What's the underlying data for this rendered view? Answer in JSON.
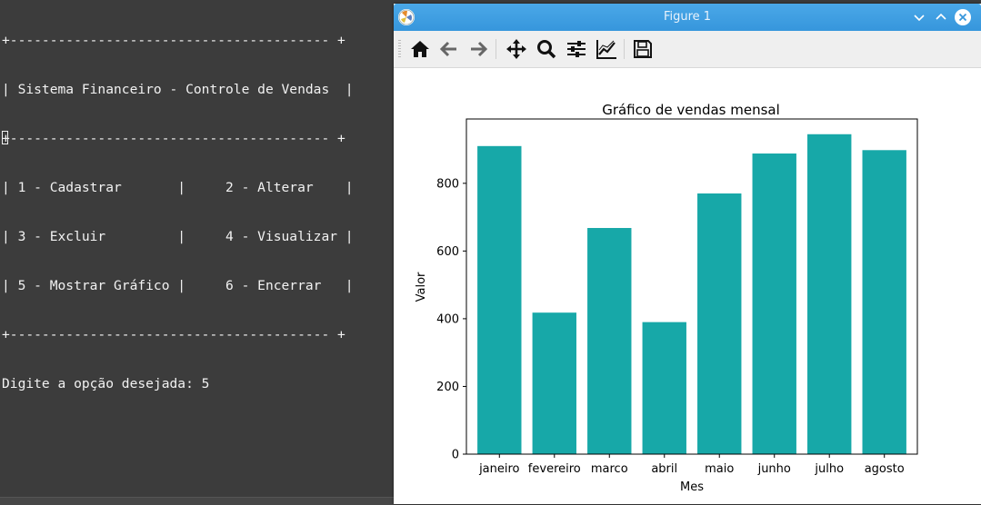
{
  "terminal": {
    "lines": [
      "+---------------------------------------- +",
      "| Sistema Financeiro - Controle de Vendas  |",
      "+---------------------------------------- +",
      "| 1 - Cadastrar       |     2 - Alterar    |",
      "| 3 - Excluir         |     4 - Visualizar |",
      "| 5 - Mostrar Gráfico |     6 - Encerrar   |",
      "+---------------------------------------- +",
      "Digite a opção desejada: 5"
    ]
  },
  "window": {
    "title": "Figure 1",
    "controls": [
      "chevron-down-icon",
      "chevron-up-icon",
      "close-icon"
    ]
  },
  "toolbar": {
    "buttons": [
      "home-icon",
      "back-arrow-icon",
      "forward-arrow-icon",
      "move-icon",
      "zoom-icon",
      "configure-subplots-icon",
      "edit-axis-icon",
      "save-icon"
    ]
  },
  "chart_data": {
    "type": "bar",
    "title": "Gráfico de vendas mensal",
    "xlabel": "Mes",
    "ylabel": "Valor",
    "categories": [
      "janeiro",
      "fevereiro",
      "marco",
      "abril",
      "maio",
      "junho",
      "julho",
      "agosto"
    ],
    "values": [
      910,
      418,
      668,
      390,
      770,
      888,
      945,
      898
    ],
    "ylim": [
      0,
      990
    ],
    "yticks": [
      0,
      200,
      400,
      600,
      800
    ],
    "bar_color": "#17a8a8",
    "grid": false
  }
}
